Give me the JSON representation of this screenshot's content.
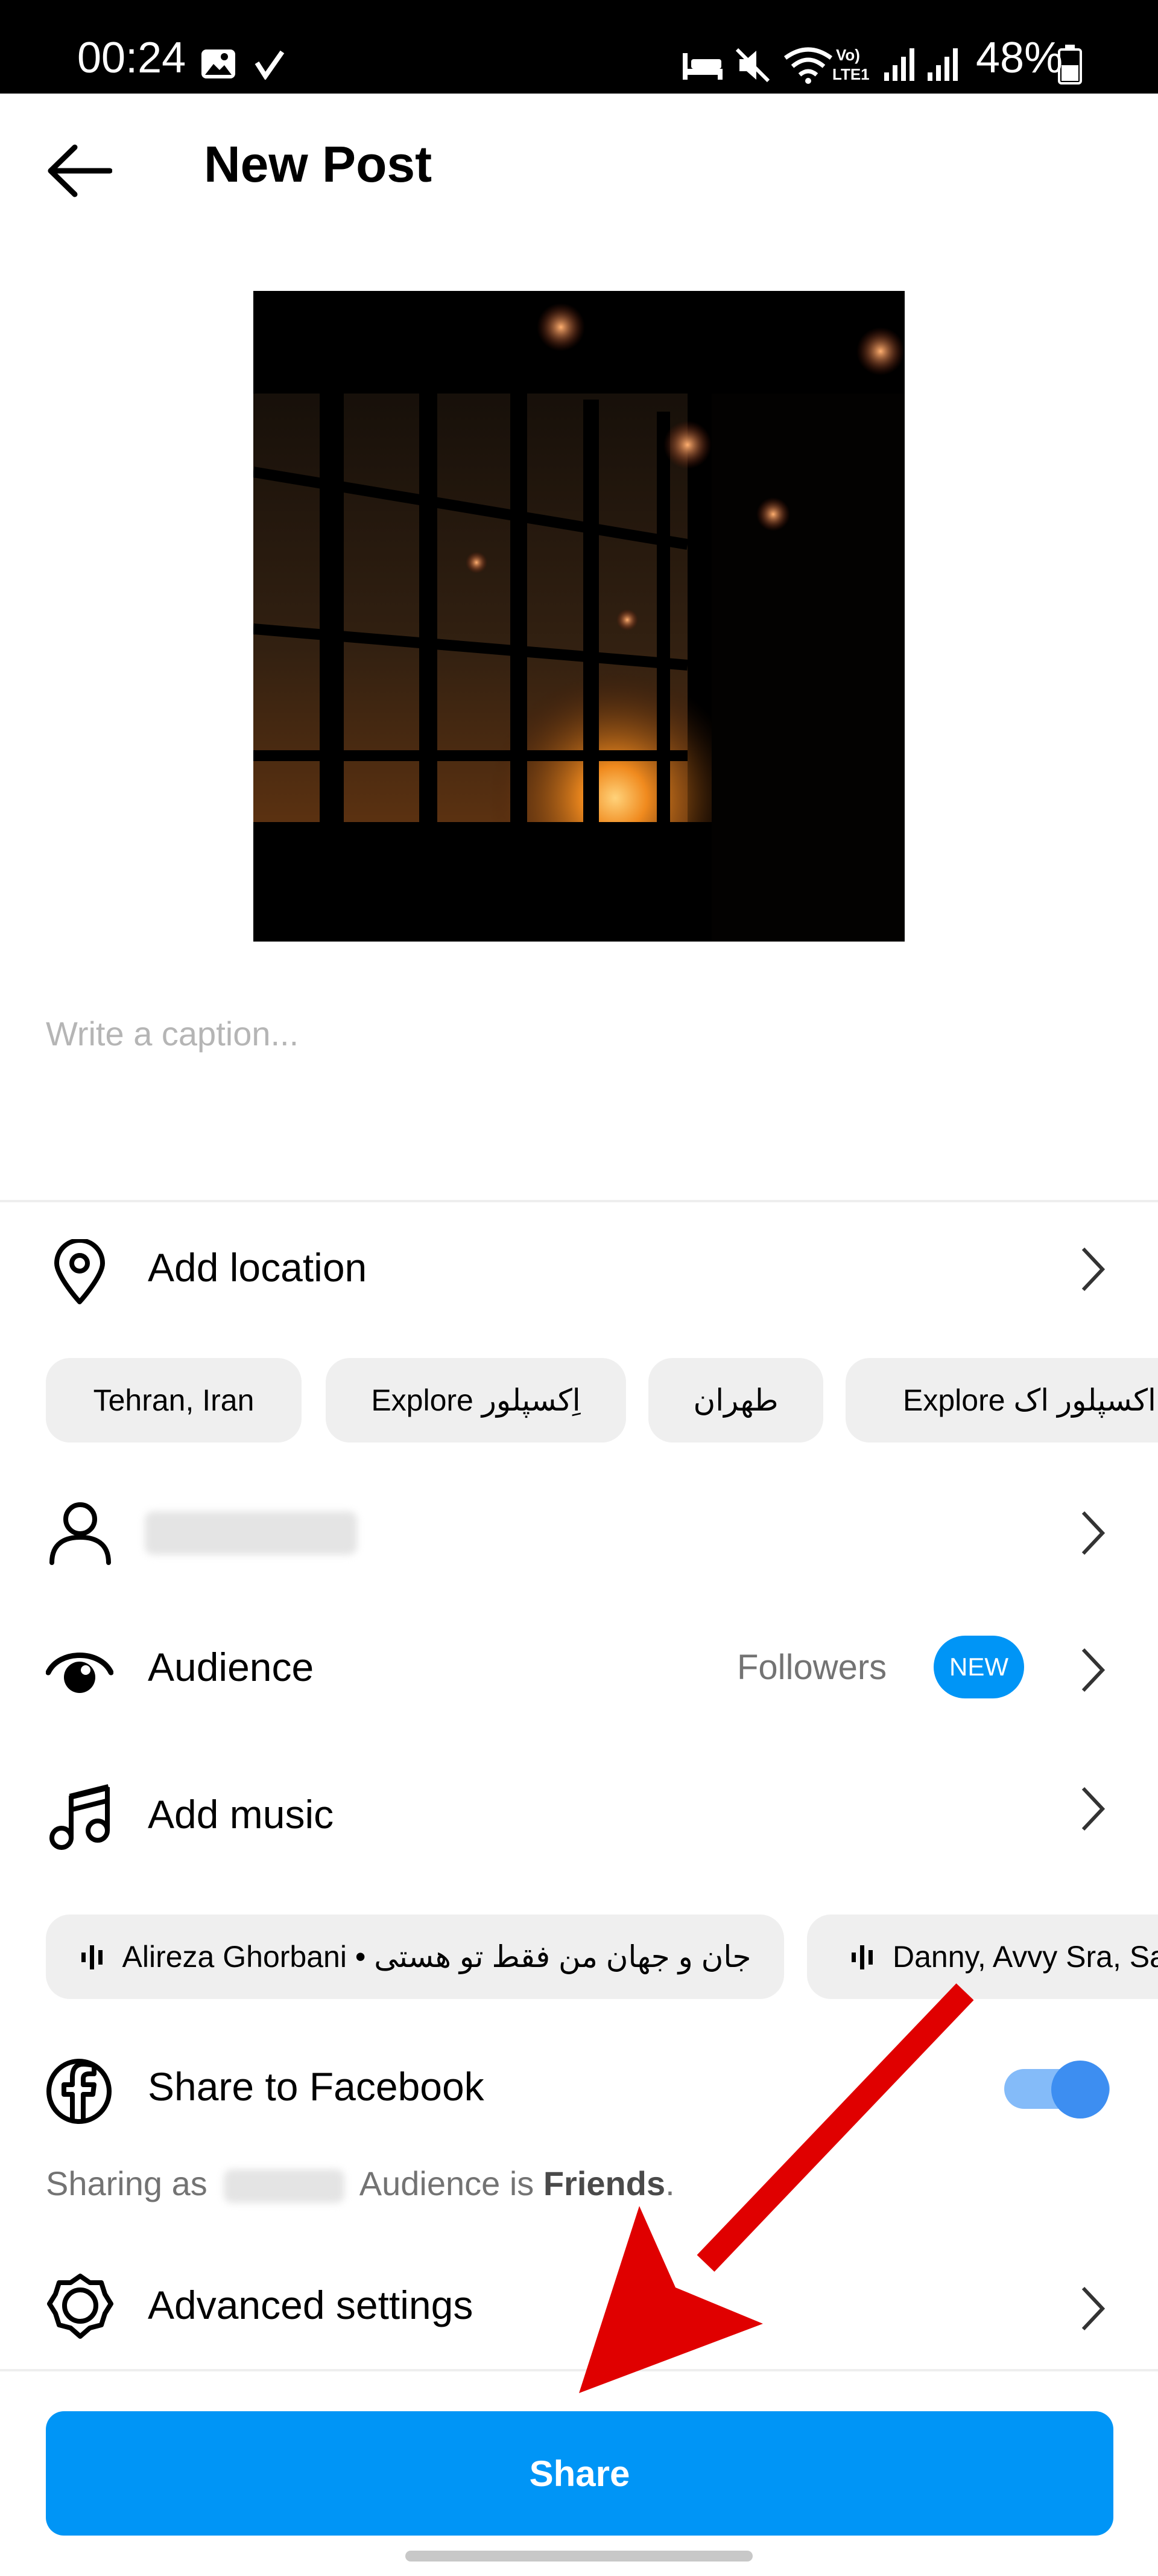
{
  "status_bar": {
    "time": "00:24",
    "battery": "48%"
  },
  "header": {
    "title": "New Post"
  },
  "caption": {
    "placeholder": "Write a caption..."
  },
  "location": {
    "label": "Add location",
    "suggestions": [
      "Tehran, Iran",
      "Explore اِکسپلور",
      "طهران",
      "Explore اکسپلور اک"
    ]
  },
  "audience": {
    "label": "Audience",
    "value": "Followers",
    "badge": "NEW"
  },
  "music": {
    "label": "Add music",
    "suggestions": [
      "Alireza Ghorbani • جان و جهان من فقط تو هستی",
      "Danny, Avvy Sra, Sa"
    ]
  },
  "facebook": {
    "label": "Share to Facebook",
    "toggle_on": true,
    "sharing_prefix": "Sharing as",
    "audience_prefix": "Audience is",
    "audience_value": "Friends",
    "audience_suffix": "."
  },
  "advanced": {
    "label": "Advanced settings"
  },
  "share_button": {
    "label": "Share"
  },
  "colors": {
    "accent": "#0095f6",
    "arrow": "#e00000",
    "toggle_track": "#84bbf9",
    "toggle_knob": "#3d8ef1"
  }
}
